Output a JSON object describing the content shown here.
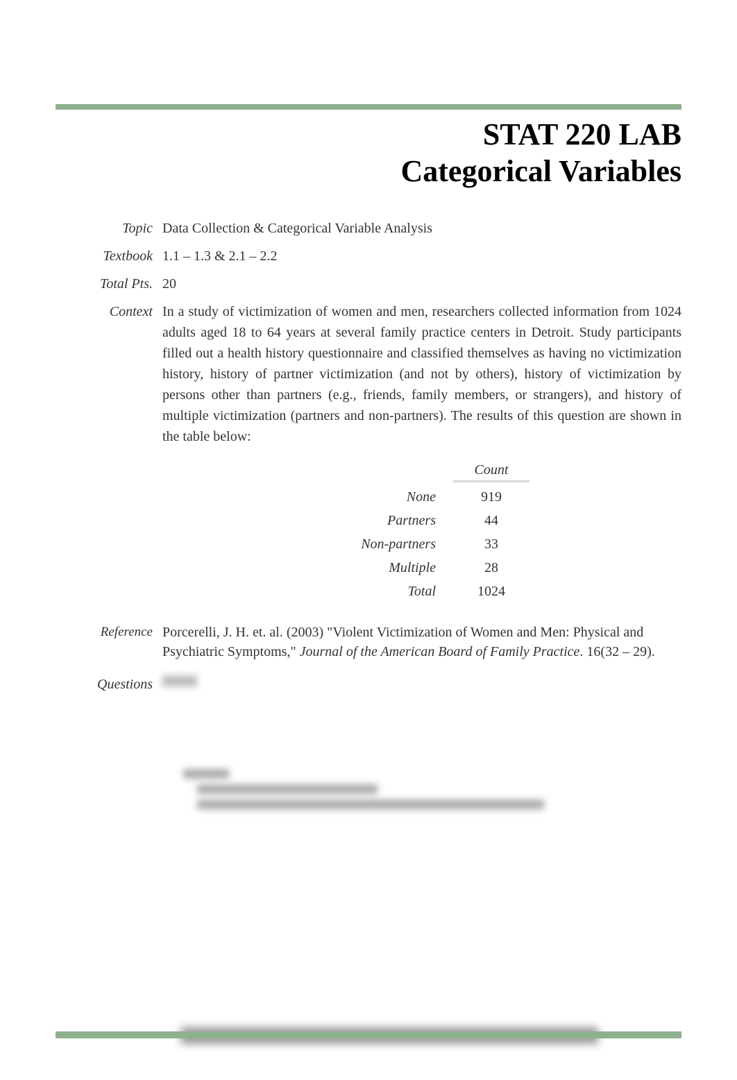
{
  "title": {
    "line1": "STAT 220 LAB",
    "line2": "Categorical Variables"
  },
  "fields": {
    "topic_label": "Topic",
    "topic_value": "Data Collection & Categorical Variable Analysis",
    "textbook_label": "Textbook",
    "textbook_value": "1.1 – 1.3 & 2.1 – 2.2",
    "totalpts_label": "Total Pts.",
    "totalpts_value": "20",
    "context_label": "Context",
    "context_value": "In a study of victimization of women and men, researchers collected information from 1024 adults aged 18 to 64 years at several family practice centers in Detroit. Study participants filled out a health history questionnaire and classified themselves as having no victimization history, history of partner victimization (and not by others), history of victimization by persons other than partners (e.g., friends, family members, or strangers), and history of multiple victimization (partners and non-partners). The results of this question are shown in the table below:",
    "reference_label": "Reference",
    "reference_prefix": "Porcerelli, J. H. et. al. (2003) \"Violent Victimization of Women and Men: Physical and Psychiatric Symptoms,\" ",
    "reference_journal": "Journal of the American Board of Family Practice",
    "reference_suffix": ". 16(32 – 29).",
    "questions_label": "Questions"
  },
  "table": {
    "count_header": "Count",
    "rows": [
      {
        "label": "None",
        "value": "919"
      },
      {
        "label": "Partners",
        "value": "44"
      },
      {
        "label": "Non-partners",
        "value": "33"
      },
      {
        "label": "Multiple",
        "value": "28"
      },
      {
        "label": "Total",
        "value": "1024"
      }
    ]
  }
}
